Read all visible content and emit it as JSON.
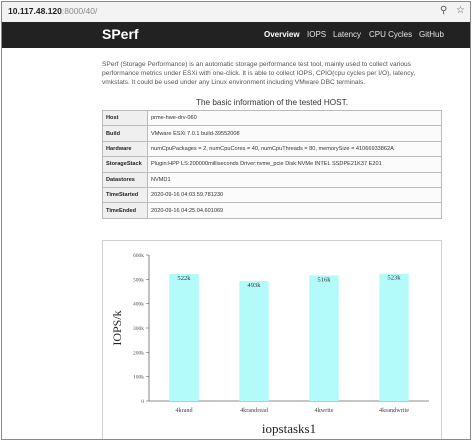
{
  "browser": {
    "url_host": "10.117.48.120",
    "url_path": ":8000/40/"
  },
  "navbar": {
    "brand": "SPerf",
    "links": [
      {
        "label": "Overview",
        "active": true
      },
      {
        "label": "IOPS",
        "active": false
      },
      {
        "label": "Latency",
        "active": false
      },
      {
        "label": "CPU Cycles",
        "active": false
      },
      {
        "label": "GitHub",
        "active": false
      }
    ]
  },
  "description": "SPerf (Storage Performance) is an automatic storage performance test tool, mainly used to collect various performance metrics under ESXi with one-click. It is able to collect IOPS, CPIO(cpu cycles per I/O), latency, vmkstats. It could be used under any Linux environment including VMware DBC terminals.",
  "host_table": {
    "title": "The basic information of the tested HOST.",
    "rows": [
      {
        "key": "Host",
        "value": "prme-hwe-drv-060"
      },
      {
        "key": "Build",
        "value": "VMware ESXi 7.0.1 build-39552008"
      },
      {
        "key": "Hardware",
        "value": "numCpuPackages = 2, numCpuCores = 40, numCpuThreads = 80, memorySize = 41066933862A"
      },
      {
        "key": "StorageStack",
        "value": "Plugin:HPP LS:200000milliseconds Driver:nvme_pcie Disk:NVMe INTEL SSDPE21K37 E201"
      },
      {
        "key": "Datastores",
        "value": "NVMD1"
      },
      {
        "key": "TimeStarted",
        "value": "2020-09-16 04:03.59.781230"
      },
      {
        "key": "TimeEnded",
        "value": "2020-09-16 04:25.04.601069"
      }
    ]
  },
  "chart_data": {
    "type": "bar",
    "categories": [
      "4krand",
      "4krandread",
      "4kwrite",
      "4krandwrite"
    ],
    "values": [
      522,
      493,
      516,
      523
    ],
    "data_labels": [
      "522k",
      "493k",
      "516k",
      "523k"
    ],
    "y_ticks": [
      "0",
      "100k",
      "200k",
      "300k",
      "400k",
      "500k",
      "600k"
    ],
    "ylim": [
      0,
      600
    ],
    "xlabel": "iopstasks1",
    "ylabel": "IOPS/k",
    "grid": false,
    "bar_color": "#b3fbfb"
  }
}
